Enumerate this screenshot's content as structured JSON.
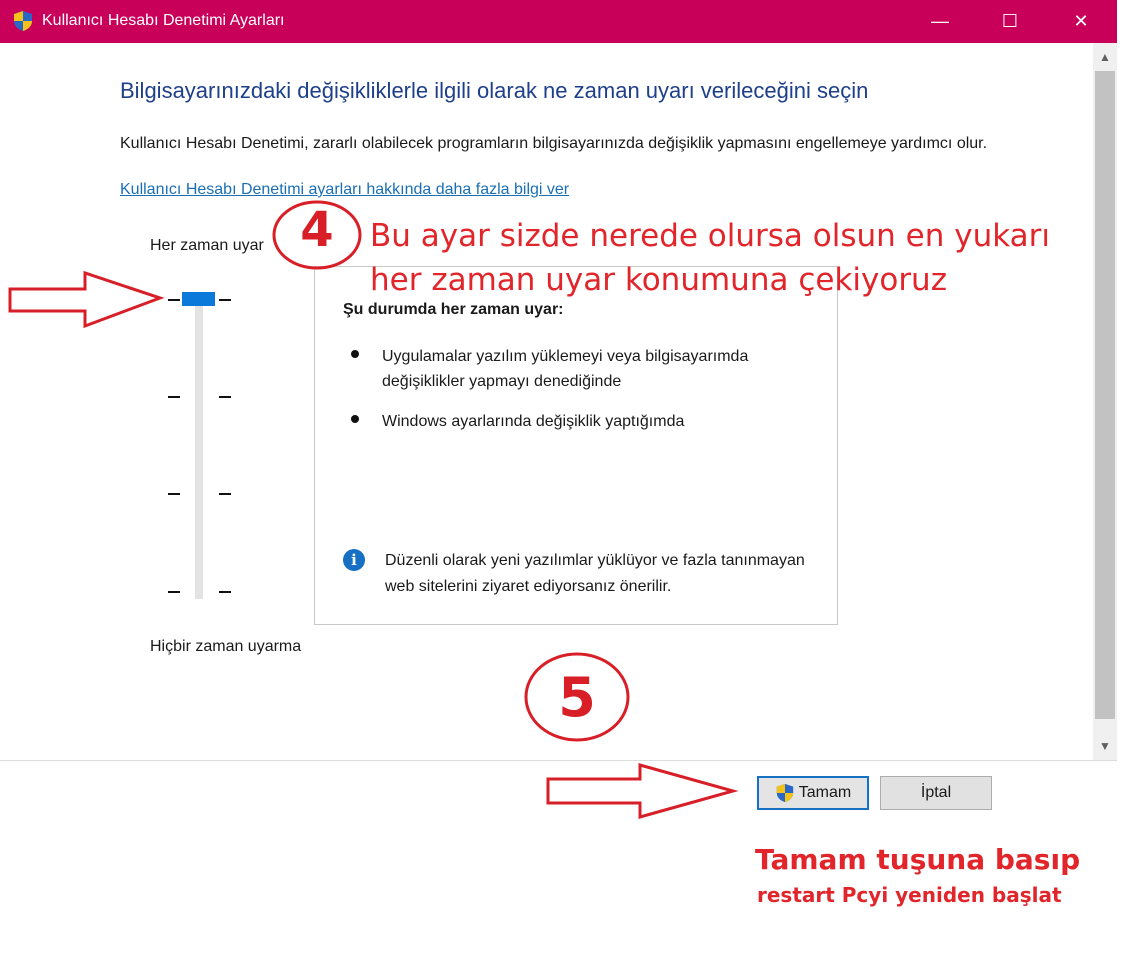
{
  "window": {
    "title": "Kullanıcı Hesabı Denetimi Ayarları",
    "minimize_glyph": "—",
    "maximize_glyph": "☐",
    "close_glyph": "✕"
  },
  "content": {
    "heading": "Bilgisayarınızdaki değişikliklerle ilgili olarak ne zaman uyarı verileceğini seçin",
    "description": "Kullanıcı Hesabı Denetimi, zararlı olabilecek programların bilgisayarınızda değişiklik yapmasını engellemeye yardımcı olur.",
    "link": "Kullanıcı Hesabı Denetimi ayarları hakkında daha fazla bilgi ver"
  },
  "slider": {
    "top_label": "Her zaman uyar",
    "bottom_label": "Hiçbir zaman uyarma",
    "levels": 4,
    "selected_level": 4
  },
  "info_box": {
    "title": "Şu durumda her zaman uyar:",
    "bullets": [
      "Uygulamalar yazılım yüklemeyi veya bilgisayarımda değişiklikler yapmayı denediğinde",
      "Windows ayarlarında değişiklik yaptığımda"
    ],
    "info_text": "Düzenli olarak yeni yazılımlar yüklüyor ve fazla tanınmayan web sitelerini ziyaret ediyorsanız önerilir."
  },
  "buttons": {
    "ok": "Tamam",
    "cancel": "İptal"
  },
  "annotations": {
    "step4_number": "4",
    "step4_text": "Bu ayar sizde nerede olursa olsun en yukarı her zaman uyar konumuna çekiyoruz",
    "step5_number": "5",
    "note_line1": "Tamam tuşuna basıp",
    "note_line2": "restart Pcyi yeniden başlat"
  },
  "colors": {
    "titlebar": "#c8005a",
    "slider_thumb": "#0a79d9",
    "annotation_red": "#e1252a",
    "heading_blue": "#1e3f8a"
  }
}
